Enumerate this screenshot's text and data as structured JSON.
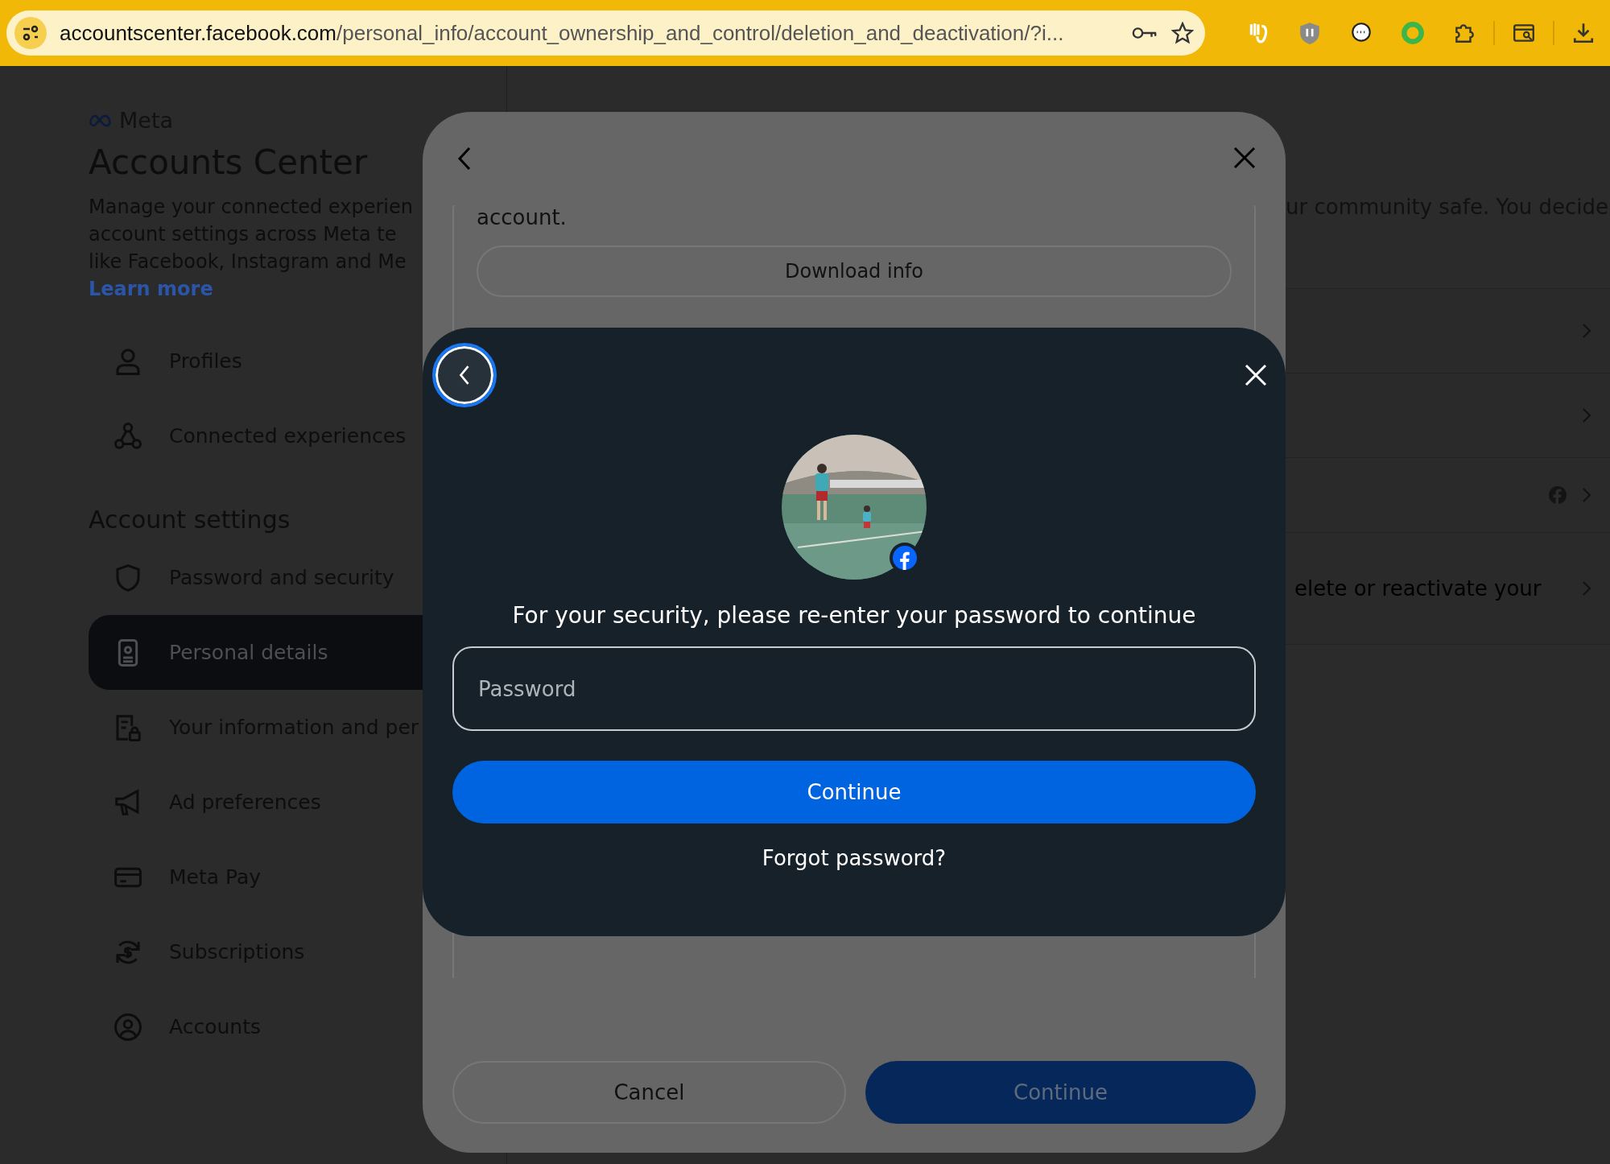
{
  "browser": {
    "url": {
      "host": "accountscenter.facebook.com",
      "path": "/personal_info/account_ownership_and_control/deletion_and_deactivation/?i..."
    }
  },
  "sidebar": {
    "brand": "Meta",
    "title": "Accounts Center",
    "description_lines": [
      "Manage your connected experien",
      "account settings across Meta te",
      "like Facebook, Instagram and Me"
    ],
    "learn_more": "Learn more",
    "items": [
      {
        "label": "Profiles",
        "selected": false
      },
      {
        "label": "Connected experiences",
        "selected": false
      }
    ],
    "section_title": "Account settings",
    "settings_items": [
      {
        "label": "Password and security",
        "selected": false
      },
      {
        "label": "Personal details",
        "selected": true
      },
      {
        "label": "Your information and per",
        "selected": false
      },
      {
        "label": "Ad preferences",
        "selected": false
      },
      {
        "label": "Meta Pay",
        "selected": false
      },
      {
        "label": "Subscriptions",
        "selected": false
      },
      {
        "label": "Accounts",
        "selected": false
      }
    ]
  },
  "main": {
    "intro": "ur community safe. You decide",
    "rows": [
      {
        "kind": "plain"
      },
      {
        "kind": "plain"
      },
      {
        "kind": "facebook"
      },
      {
        "kind": "text",
        "label": "elete or reactivate your"
      }
    ]
  },
  "back_dialog": {
    "text": "account.",
    "download_button": "Download info",
    "cancel_button": "Cancel",
    "continue_button": "Continue"
  },
  "password_dialog": {
    "heading": "For your security, please re-enter your password to continue",
    "password_field": {
      "placeholder": "Password"
    },
    "continue_button": "Continue",
    "forgot_link": "Forgot password?"
  }
}
